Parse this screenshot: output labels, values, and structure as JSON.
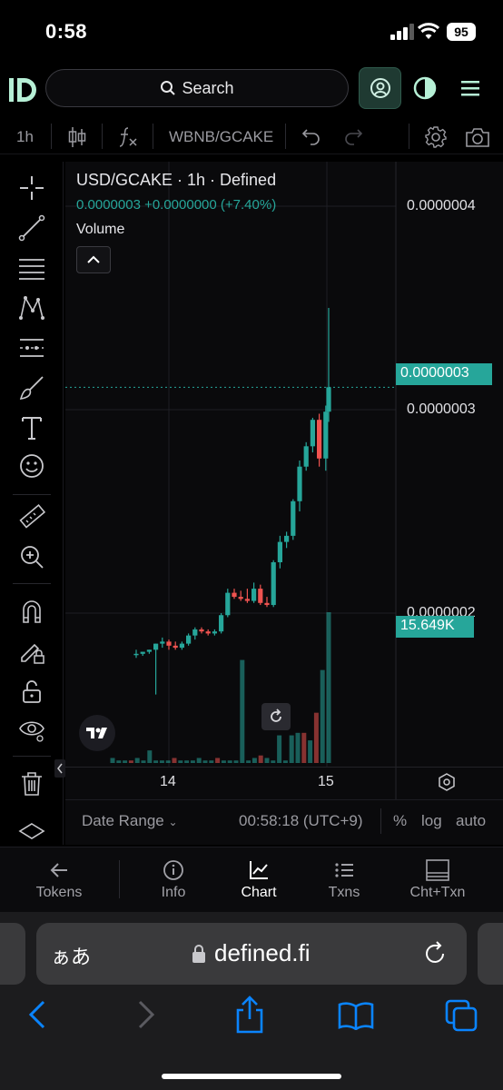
{
  "status_bar": {
    "time": "0:58",
    "battery": "95"
  },
  "header": {
    "logo": "D",
    "search_label": "Search",
    "icons": [
      "search-icon",
      "user-icon",
      "theme-icon",
      "menu-icon"
    ]
  },
  "toolbar": {
    "interval": "1h",
    "pair": "WBNB/GCAKE",
    "icons": [
      "candles-icon",
      "indicator-fx-icon",
      "undo-icon",
      "redo-icon",
      "gear-icon",
      "camera-icon"
    ]
  },
  "left_tools": [
    "crosshair-icon",
    "trendline-icon",
    "fib-icon",
    "pattern-icon",
    "prediction-icon",
    "brush-icon",
    "text-icon",
    "emoji-icon",
    "ruler-icon",
    "zoom-in-icon",
    "magnet-icon",
    "lock-drawing-icon",
    "unlock-icon",
    "eye-icon",
    "trash-icon"
  ],
  "legend": {
    "title": "USD/GCAKE · 1h · Defined",
    "values": "0.0000003 +0.0000000 (+7.40%)",
    "volume": "Volume"
  },
  "price_axis": {
    "labels": [
      "0.0000004",
      "0.0000003",
      "0.0000002"
    ],
    "last_price_tag": "0.0000003",
    "volume_tag": "15.649K"
  },
  "time_axis": {
    "labels": [
      "14",
      "15"
    ]
  },
  "bottom_bar": {
    "date_range": "Date Range",
    "clock": "00:58:18 (UTC+9)",
    "percent": "%",
    "log": "log",
    "auto": "auto"
  },
  "tabs": [
    {
      "label": "Tokens",
      "icon": "arrow-left-icon"
    },
    {
      "label": "Info",
      "icon": "info-icon"
    },
    {
      "label": "Chart",
      "icon": "chart-icon"
    },
    {
      "label": "Txns",
      "icon": "list-icon"
    },
    {
      "label": "Cht+Txn",
      "icon": "split-icon"
    }
  ],
  "safari": {
    "aa": "ぁあ",
    "domain": "defined.fi"
  },
  "colors": {
    "up": "#26a69a",
    "down": "#ef5350",
    "accent": "#26a69a"
  },
  "chart_data": {
    "type": "candlestick",
    "series": [
      {
        "name": "Price",
        "candles": [
          {
            "o": 1.8e-07,
            "h": 1.82e-07,
            "l": 1.78e-07,
            "c": 1.8e-07
          },
          {
            "o": 1.8e-07,
            "h": 1.81e-07,
            "l": 1.79e-07,
            "c": 1.81e-07
          },
          {
            "o": 1.81e-07,
            "h": 1.82e-07,
            "l": 1.8e-07,
            "c": 1.82e-07
          },
          {
            "o": 1.82e-07,
            "h": 1.85e-07,
            "l": 1.6e-07,
            "c": 1.85e-07
          },
          {
            "o": 1.85e-07,
            "h": 1.88e-07,
            "l": 1.83e-07,
            "c": 1.86e-07
          },
          {
            "o": 1.86e-07,
            "h": 1.87e-07,
            "l": 1.82e-07,
            "c": 1.84e-07
          },
          {
            "o": 1.84e-07,
            "h": 1.86e-07,
            "l": 1.82e-07,
            "c": 1.83e-07
          },
          {
            "o": 1.83e-07,
            "h": 1.86e-07,
            "l": 1.82e-07,
            "c": 1.85e-07
          },
          {
            "o": 1.85e-07,
            "h": 1.9e-07,
            "l": 1.84e-07,
            "c": 1.89e-07
          },
          {
            "o": 1.89e-07,
            "h": 1.93e-07,
            "l": 1.87e-07,
            "c": 1.92e-07
          },
          {
            "o": 1.92e-07,
            "h": 1.93e-07,
            "l": 1.9e-07,
            "c": 1.91e-07
          },
          {
            "o": 1.91e-07,
            "h": 1.92e-07,
            "l": 1.89e-07,
            "c": 1.9e-07
          },
          {
            "o": 1.9e-07,
            "h": 1.92e-07,
            "l": 1.89e-07,
            "c": 1.91e-07
          },
          {
            "o": 1.91e-07,
            "h": 2e-07,
            "l": 1.9e-07,
            "c": 1.99e-07
          },
          {
            "o": 1.99e-07,
            "h": 2.12e-07,
            "l": 1.98e-07,
            "c": 2.1e-07
          },
          {
            "o": 2.1e-07,
            "h": 2.12e-07,
            "l": 2.07e-07,
            "c": 2.08e-07
          },
          {
            "o": 2.08e-07,
            "h": 2.11e-07,
            "l": 2.06e-07,
            "c": 2.07e-07
          },
          {
            "o": 2.07e-07,
            "h": 2.12e-07,
            "l": 2.05e-07,
            "c": 2.06e-07
          },
          {
            "o": 2.06e-07,
            "h": 2.15e-07,
            "l": 2.05e-07,
            "c": 2.12e-07
          },
          {
            "o": 2.12e-07,
            "h": 2.14e-07,
            "l": 2.04e-07,
            "c": 2.05e-07
          },
          {
            "o": 2.05e-07,
            "h": 2.08e-07,
            "l": 2.03e-07,
            "c": 2.04e-07
          },
          {
            "o": 2.04e-07,
            "h": 2.26e-07,
            "l": 2.03e-07,
            "c": 2.25e-07
          },
          {
            "o": 2.25e-07,
            "h": 2.38e-07,
            "l": 2.22e-07,
            "c": 2.35e-07
          },
          {
            "o": 2.35e-07,
            "h": 2.4e-07,
            "l": 2.32e-07,
            "c": 2.38e-07
          },
          {
            "o": 2.38e-07,
            "h": 2.56e-07,
            "l": 2.36e-07,
            "c": 2.55e-07
          },
          {
            "o": 2.55e-07,
            "h": 2.75e-07,
            "l": 2.5e-07,
            "c": 2.72e-07
          },
          {
            "o": 2.72e-07,
            "h": 2.84e-07,
            "l": 2.7e-07,
            "c": 2.82e-07
          },
          {
            "o": 2.82e-07,
            "h": 2.96e-07,
            "l": 2.79e-07,
            "c": 2.95e-07
          },
          {
            "o": 2.95e-07,
            "h": 2.98e-07,
            "l": 2.72e-07,
            "c": 2.76e-07
          },
          {
            "o": 2.76e-07,
            "h": 3.02e-07,
            "l": 2.7e-07,
            "c": 2.99e-07
          },
          {
            "o": 2.99e-07,
            "h": 3.5e-07,
            "l": 2.94e-07,
            "c": 3.11e-07
          }
        ]
      }
    ],
    "volume": [
      2,
      1,
      1,
      1,
      2,
      1,
      5,
      1,
      1,
      1,
      2,
      1,
      1,
      1,
      2,
      1,
      1,
      2,
      1,
      1,
      1,
      41,
      1,
      2,
      3,
      2,
      1,
      11,
      1,
      11,
      12,
      12,
      9,
      20,
      37,
      60
    ]
  }
}
